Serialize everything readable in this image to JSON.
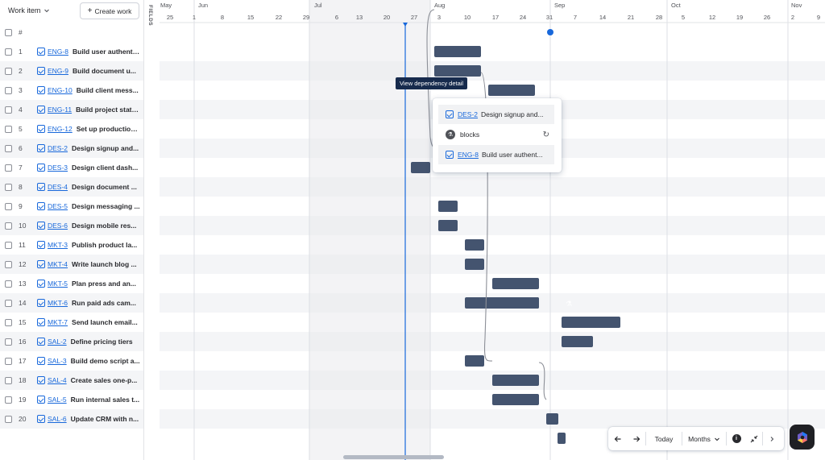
{
  "list": {
    "work_item_label": "Work item",
    "create_label": "Create work",
    "col_number": "#",
    "rows": [
      {
        "n": "1",
        "key": "ENG-8",
        "title": "Build user authenti..."
      },
      {
        "n": "2",
        "key": "ENG-9",
        "title": "Build document u..."
      },
      {
        "n": "3",
        "key": "ENG-10",
        "title": "Build client mess..."
      },
      {
        "n": "4",
        "key": "ENG-11",
        "title": "Build project statu..."
      },
      {
        "n": "5",
        "key": "ENG-12",
        "title": "Set up production..."
      },
      {
        "n": "6",
        "key": "DES-2",
        "title": "Design signup and..."
      },
      {
        "n": "7",
        "key": "DES-3",
        "title": "Design client dash..."
      },
      {
        "n": "8",
        "key": "DES-4",
        "title": "Design document ..."
      },
      {
        "n": "9",
        "key": "DES-5",
        "title": "Design messaging ..."
      },
      {
        "n": "10",
        "key": "DES-6",
        "title": "Design mobile res..."
      },
      {
        "n": "11",
        "key": "MKT-3",
        "title": "Publish product la..."
      },
      {
        "n": "12",
        "key": "MKT-4",
        "title": "Write launch blog ..."
      },
      {
        "n": "13",
        "key": "MKT-5",
        "title": "Plan press and an..."
      },
      {
        "n": "14",
        "key": "MKT-6",
        "title": "Run paid ads cam..."
      },
      {
        "n": "15",
        "key": "MKT-7",
        "title": "Send launch email..."
      },
      {
        "n": "16",
        "key": "SAL-2",
        "title": "Define pricing tiers"
      },
      {
        "n": "17",
        "key": "SAL-3",
        "title": "Build demo script a..."
      },
      {
        "n": "18",
        "key": "SAL-4",
        "title": "Create sales one-p..."
      },
      {
        "n": "19",
        "key": "SAL-5",
        "title": "Run internal sales t..."
      },
      {
        "n": "20",
        "key": "SAL-6",
        "title": "Update CRM with n..."
      }
    ]
  },
  "fields_tab_label": "FIELDS",
  "timeline": {
    "months": [
      "May",
      "Jun",
      "Jul",
      "Aug",
      "Sep",
      "Oct",
      "Nov"
    ],
    "days": [
      "25",
      "1",
      "8",
      "15",
      "22",
      "29",
      "6",
      "13",
      "20",
      "27",
      "3",
      "10",
      "17",
      "24",
      "31",
      "7",
      "14",
      "21",
      "28",
      "5",
      "12",
      "19",
      "26",
      "2",
      "9"
    ],
    "tooltip": "View dependency detail"
  },
  "dependency_popup": {
    "from_key": "DES-2",
    "from_title": "Design signup and...",
    "relation": "blocks",
    "to_key": "ENG-8",
    "to_title": "Build user authent..."
  },
  "toolbar": {
    "prev_icon": "arrow-left-icon",
    "next_icon": "arrow-right-icon",
    "today_label": "Today",
    "scale_label": "Months",
    "info_icon": "info-icon",
    "collapse_icon": "collapse-icon",
    "more_icon": "chevron-right-icon"
  },
  "colors": {
    "bar": "#44546f",
    "today_line": "#1868db",
    "link": "#1868db"
  }
}
